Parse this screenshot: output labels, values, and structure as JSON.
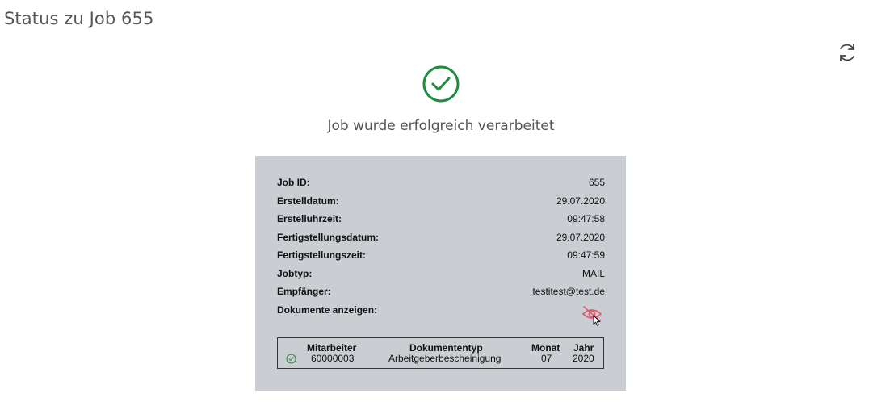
{
  "page": {
    "title": "Status zu Job 655"
  },
  "icons": {
    "refresh": "refresh-icon",
    "success": "check-circle-icon",
    "eye": "eye-slash-icon",
    "row_status": "check-circle-icon"
  },
  "colors": {
    "success": "#1e8e3e",
    "eye": "#e05a6b",
    "panel_bg": "#cacdd2"
  },
  "status": {
    "message": "Job wurde erfolgreich verarbeitet"
  },
  "details": [
    {
      "label": "Job ID:",
      "value": "655"
    },
    {
      "label": "Erstelldatum:",
      "value": "29.07.2020"
    },
    {
      "label": "Erstelluhrzeit:",
      "value": "09:47:58"
    },
    {
      "label": "Fertigstellungsdatum:",
      "value": "29.07.2020"
    },
    {
      "label": "Fertigstellungszeit:",
      "value": "09:47:59"
    },
    {
      "label": "Jobtyp:",
      "value": "MAIL"
    },
    {
      "label": "Empfänger:",
      "value": "testitest@test.de"
    },
    {
      "label": "Dokumente anzeigen:",
      "value": ""
    }
  ],
  "documents": {
    "headers": {
      "mitarbeiter": "Mitarbeiter",
      "dokumententyp": "Dokumententyp",
      "monat": "Monat",
      "jahr": "Jahr"
    },
    "rows": [
      {
        "mitarbeiter": "60000003",
        "dokumententyp": "Arbeitgeberbescheinigung",
        "monat": "07",
        "jahr": "2020"
      }
    ]
  }
}
